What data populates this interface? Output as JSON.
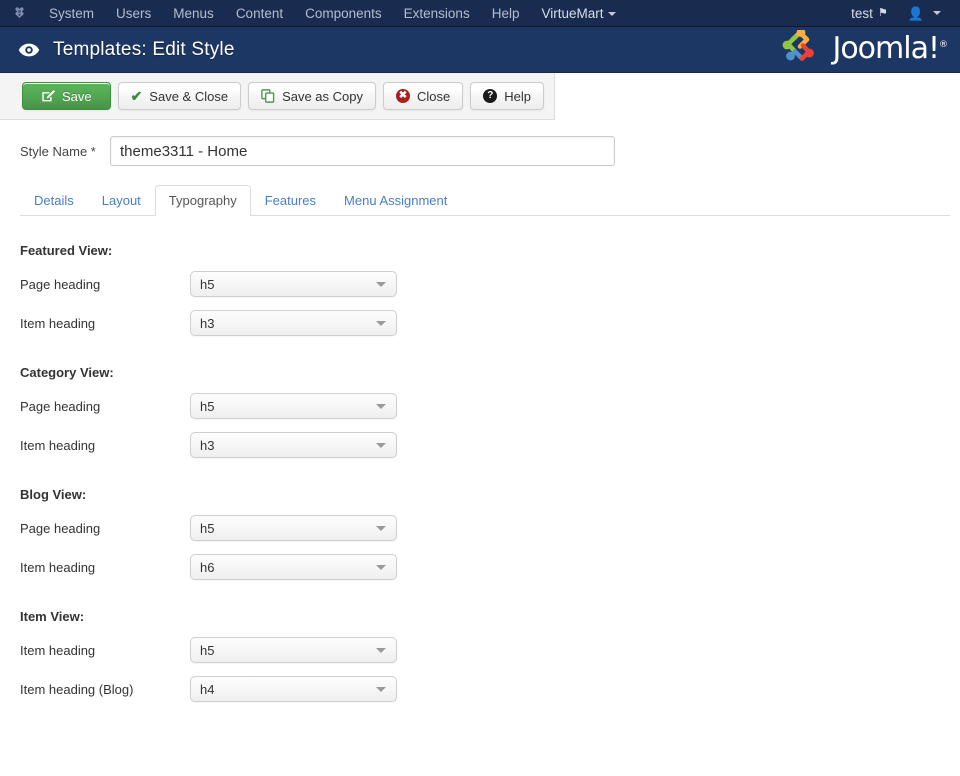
{
  "topbar": {
    "brand_icon": "joomla-brand-icon",
    "menu": [
      {
        "label": "System",
        "has_caret": false
      },
      {
        "label": "Users",
        "has_caret": false
      },
      {
        "label": "Menus",
        "has_caret": false
      },
      {
        "label": "Content",
        "has_caret": false
      },
      {
        "label": "Components",
        "has_caret": false
      },
      {
        "label": "Extensions",
        "has_caret": false
      },
      {
        "label": "Help",
        "has_caret": false
      },
      {
        "label": "VirtueMart",
        "has_caret": true
      }
    ],
    "site_link_label": "test",
    "site_link_icon": "external-link-icon",
    "user_icon": "user-icon"
  },
  "header": {
    "icon": "eye-icon",
    "title": "Templates: Edit Style",
    "logo_text": "Joomla!",
    "logo_reg": "®"
  },
  "toolbar": {
    "save_label": "Save",
    "save_icon": "edit-pencil-icon",
    "save_close_label": "Save & Close",
    "save_close_icon": "check-icon",
    "save_copy_label": "Save as Copy",
    "save_copy_icon": "copy-icon",
    "close_label": "Close",
    "close_icon": "close-circle-icon",
    "help_label": "Help",
    "help_icon": "question-circle-icon"
  },
  "form": {
    "style_name_label": "Style Name *",
    "style_name_value": "theme3311 - Home",
    "style_name_placeholder": ""
  },
  "tabs": [
    {
      "label": "Details",
      "active": false
    },
    {
      "label": "Layout",
      "active": false
    },
    {
      "label": "Typography",
      "active": true
    },
    {
      "label": "Features",
      "active": false
    },
    {
      "label": "Menu Assignment",
      "active": false
    }
  ],
  "typography": {
    "groups": [
      {
        "title": "Featured View:",
        "fields": [
          {
            "label": "Page heading",
            "value": "h5"
          },
          {
            "label": "Item heading",
            "value": "h3"
          }
        ]
      },
      {
        "title": "Category View:",
        "fields": [
          {
            "label": "Page heading",
            "value": "h5"
          },
          {
            "label": "Item heading",
            "value": "h3"
          }
        ]
      },
      {
        "title": "Blog View:",
        "fields": [
          {
            "label": "Page heading",
            "value": "h5"
          },
          {
            "label": "Item heading",
            "value": "h6"
          }
        ]
      },
      {
        "title": "Item View:",
        "fields": [
          {
            "label": "Item heading",
            "value": "h5"
          },
          {
            "label": "Item heading (Blog)",
            "value": "h4"
          }
        ]
      }
    ]
  },
  "colors": {
    "topbar_bg": "#1a2b50",
    "header_bg": "#1c3764",
    "save_green": "#51a351",
    "tab_link": "#4a7ec4",
    "toolbar_bg": "#f4f4f4"
  }
}
